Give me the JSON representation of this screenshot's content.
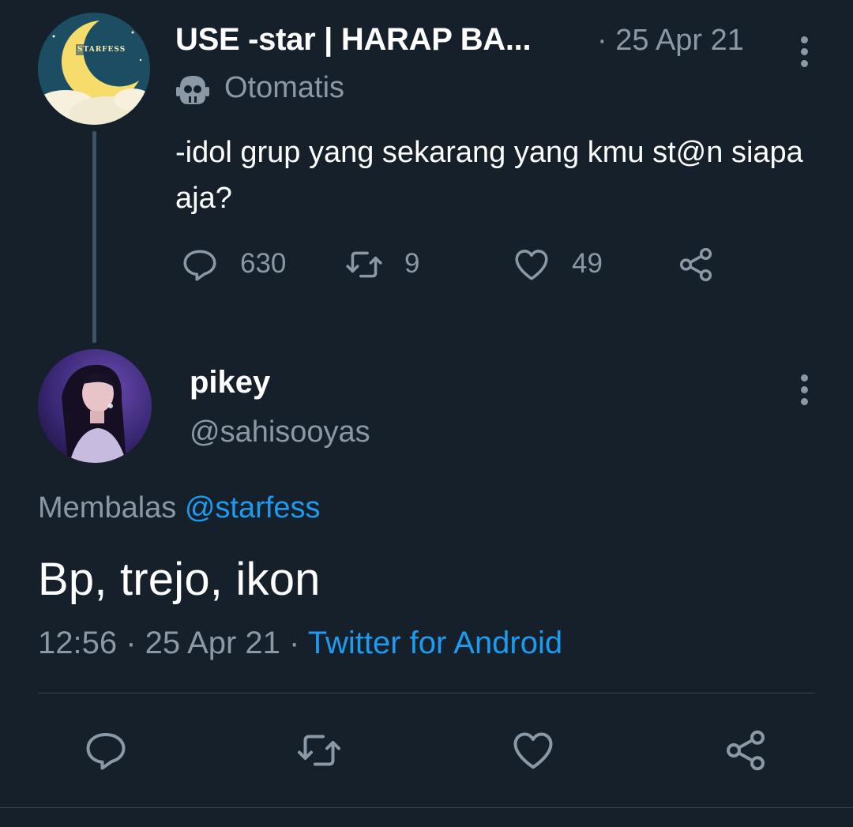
{
  "parent_tweet": {
    "display_name": "USE -star | HARAP BA...",
    "date": "· 25 Apr 21",
    "label": "Otomatis",
    "avatar_text": "STARFESS",
    "text": "-idol grup yang sekarang yang kmu st@n siapa aja?",
    "stats": {
      "replies": "630",
      "retweets": "9",
      "likes": "49"
    },
    "icons": {
      "more": "more-vertical-icon",
      "bot": "robot-icon",
      "reply": "reply-icon",
      "retweet": "retweet-icon",
      "like": "heart-icon",
      "share": "share-icon"
    }
  },
  "reply_tweet": {
    "display_name": "pikey",
    "handle": "@sahisooyas",
    "replying_prefix": "Membalas",
    "replying_to": "@starfess",
    "text": "Bp, trejo, ikon",
    "time": "12:56",
    "date": "25 Apr 21",
    "client": "Twitter for Android"
  },
  "colors": {
    "background": "#15202b",
    "text_primary": "#ffffff",
    "text_secondary": "#8b98a5",
    "link": "#1d9bf0",
    "divider": "#38444d"
  }
}
